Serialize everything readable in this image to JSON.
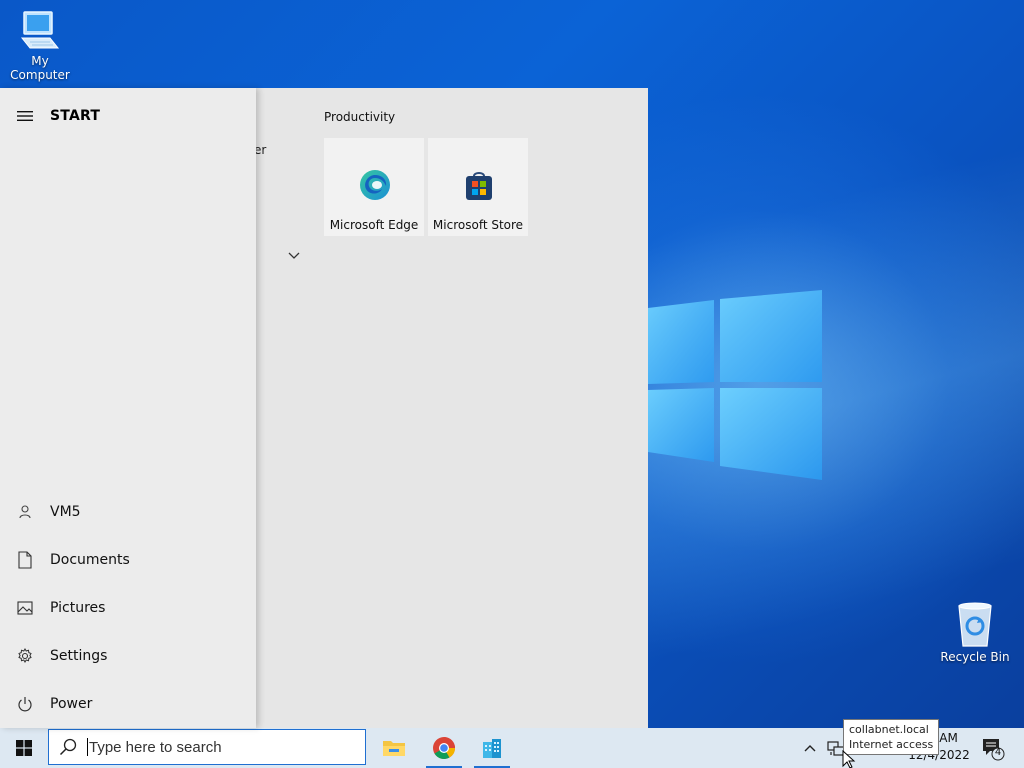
{
  "desktop": {
    "icons": [
      {
        "label": "My Computer",
        "icon": "computer-icon"
      },
      {
        "label": "Recycle Bin",
        "icon": "recycle-bin-icon"
      }
    ]
  },
  "start_menu": {
    "title": "START",
    "nav_items": [
      {
        "label": "VM5",
        "icon": "user-icon"
      },
      {
        "label": "Documents",
        "icon": "document-icon"
      },
      {
        "label": "Pictures",
        "icon": "pictures-icon"
      },
      {
        "label": "Settings",
        "icon": "gear-icon"
      },
      {
        "label": "Power",
        "icon": "power-icon"
      }
    ],
    "partial_app_text": "er",
    "tile_group": {
      "title": "Productivity",
      "tiles": [
        {
          "label": "Microsoft Edge",
          "icon": "edge-icon"
        },
        {
          "label": "Microsoft Store",
          "icon": "store-icon"
        }
      ]
    }
  },
  "taskbar": {
    "search_placeholder": "Type here to search",
    "pinned_apps": [
      {
        "name": "File Explorer",
        "icon": "folder-icon"
      },
      {
        "name": "Google Chrome",
        "icon": "chrome-icon"
      },
      {
        "name": "App",
        "icon": "building-icon"
      }
    ],
    "clock_time": "34 AM",
    "clock_date": "12/4/2022",
    "notification_count": "4"
  },
  "tooltip": {
    "line1": "collabnet.local",
    "line2": "Internet access"
  },
  "colors": {
    "accent": "#1f6fd1",
    "desktop_blue": "#0b63d6",
    "start_bg": "#e6e6e6",
    "taskbar_bg": "#dde8f2"
  }
}
